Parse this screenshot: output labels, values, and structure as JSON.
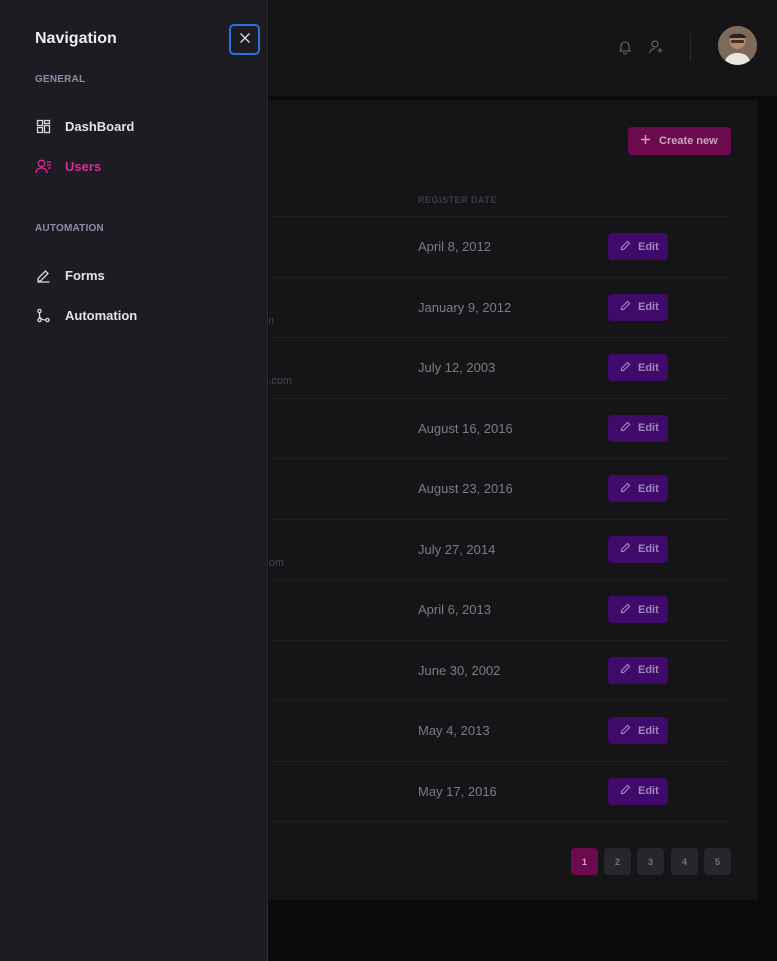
{
  "drawer": {
    "title": "Navigation",
    "sections": [
      {
        "label": "GENERAL",
        "items": [
          {
            "label": "DashBoard",
            "icon": "dashboard-icon",
            "active": false
          },
          {
            "label": "Users",
            "icon": "users-icon",
            "active": true
          }
        ]
      },
      {
        "label": "AUTOMATION",
        "items": [
          {
            "label": "Forms",
            "icon": "pen-icon",
            "active": false
          },
          {
            "label": "Automation",
            "icon": "branch-icon",
            "active": false
          }
        ]
      }
    ]
  },
  "toolbar": {
    "create_label": "Create new"
  },
  "table": {
    "date_header": "REGISTER DATE",
    "edit_label": "Edit",
    "rows": [
      {
        "date": "April 8, 2012",
        "email_fragment": "n"
      },
      {
        "date": "January 9, 2012",
        "email_fragment": "m"
      },
      {
        "date": "July 12, 2003",
        "email_fragment": ".com"
      },
      {
        "date": "August 16, 2016",
        "email_fragment": ""
      },
      {
        "date": "August 23, 2016",
        "email_fragment": ""
      },
      {
        "date": "July 27, 2014",
        "email_fragment": "om"
      },
      {
        "date": "April 6, 2013",
        "email_fragment": ""
      },
      {
        "date": "June 30, 2002",
        "email_fragment": ""
      },
      {
        "date": "May 4, 2013",
        "email_fragment": "n"
      },
      {
        "date": "May 17, 2016",
        "email_fragment": ""
      }
    ]
  },
  "pagination": {
    "pages": [
      "1",
      "2",
      "3",
      "4",
      "5"
    ],
    "current": "1"
  },
  "colors": {
    "accent": "#d92b9a",
    "edit": "#3f0a6a",
    "focus": "#2f6fd6"
  }
}
